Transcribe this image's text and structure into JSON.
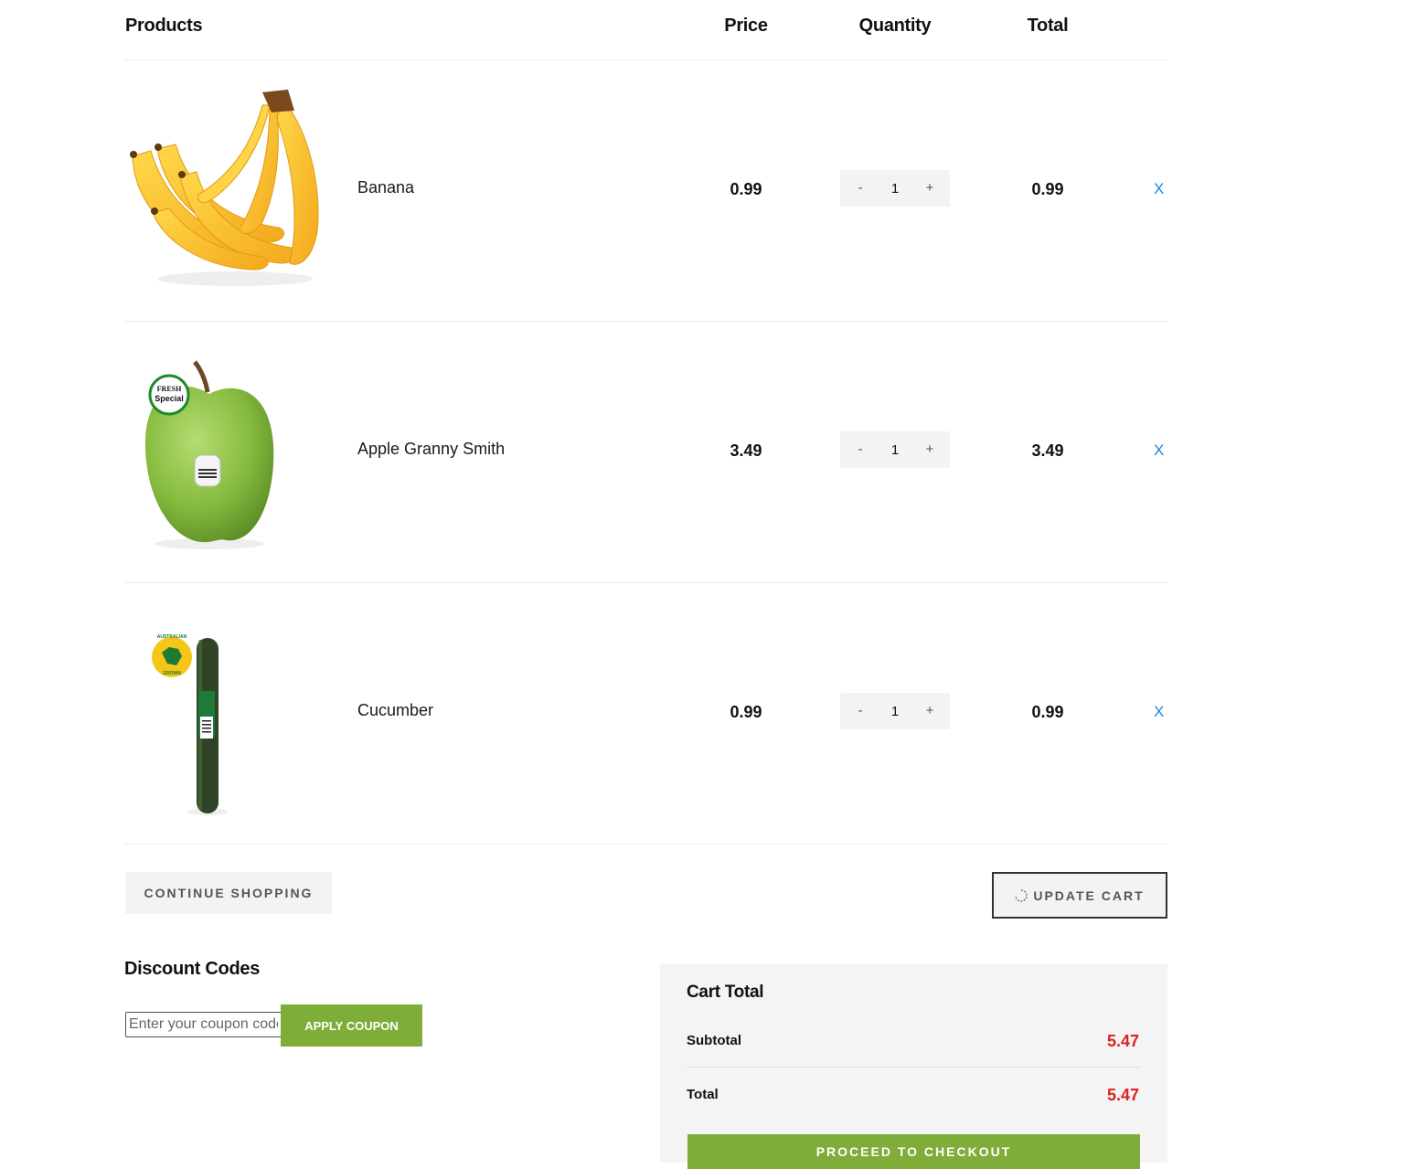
{
  "table": {
    "headers": {
      "products": "Products",
      "price": "Price",
      "quantity": "Quantity",
      "total": "Total"
    }
  },
  "items": [
    {
      "name": "Banana",
      "price": "0.99",
      "quantity": "1",
      "total": "0.99",
      "minus": "-",
      "plus": "+",
      "remove": "X",
      "image": "banana"
    },
    {
      "name": "Apple Granny Smith",
      "price": "3.49",
      "quantity": "1",
      "total": "3.49",
      "minus": "-",
      "plus": "+",
      "remove": "X",
      "image": "green-apple",
      "sticker": {
        "line1": "FRESH",
        "line2": "Special"
      }
    },
    {
      "name": "Cucumber",
      "price": "0.99",
      "quantity": "1",
      "total": "0.99",
      "minus": "-",
      "plus": "+",
      "remove": "X",
      "image": "cucumber",
      "sticker": {
        "line1": "AUSTRALIAN",
        "line2": "GROWN"
      }
    }
  ],
  "actions": {
    "continue_shopping": "CONTINUE SHOPPING",
    "update_cart": "UPDATE CART"
  },
  "discount": {
    "title": "Discount Codes",
    "placeholder": "Enter your coupon code",
    "apply": "APPLY COUPON"
  },
  "cart_total": {
    "title": "Cart Total",
    "subtotal_label": "Subtotal",
    "subtotal_value": "5.47",
    "total_label": "Total",
    "total_value": "5.47",
    "checkout": "PROCEED TO CHECKOUT"
  },
  "colors": {
    "accent_green": "#7fad39",
    "price_red": "#dd2222",
    "link_blue": "#1e88e5",
    "panel_gray": "#f4f4f4"
  }
}
